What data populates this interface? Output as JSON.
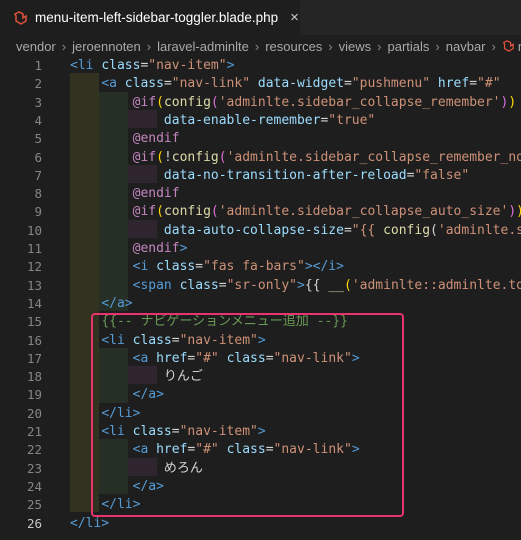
{
  "tab": {
    "filename": "menu-item-left-sidebar-toggler.blade.php",
    "close_icon": "×"
  },
  "breadcrumb": [
    "vendor",
    "jeroennoten",
    "laravel-adminlte",
    "resources",
    "views",
    "partials",
    "navbar",
    "me"
  ],
  "active_line": 26,
  "annotation_color": "#e8336e",
  "lines": [
    {
      "n": "1",
      "parts": [
        {
          "c": "t",
          "v": "<li"
        },
        {
          "c": "w",
          "v": " "
        },
        {
          "c": "a",
          "v": "class"
        },
        {
          "c": "w",
          "v": "="
        },
        {
          "c": "s",
          "v": "\"nav-item\""
        },
        {
          "c": "t",
          "v": ">"
        }
      ]
    },
    {
      "n": "2",
      "parts": [
        {
          "c": "w",
          "v": "    "
        },
        {
          "c": "t",
          "v": "<a"
        },
        {
          "c": "w",
          "v": " "
        },
        {
          "c": "a",
          "v": "class"
        },
        {
          "c": "w",
          "v": "="
        },
        {
          "c": "s",
          "v": "\"nav-link\""
        },
        {
          "c": "w",
          "v": " "
        },
        {
          "c": "a",
          "v": "data-widget"
        },
        {
          "c": "w",
          "v": "="
        },
        {
          "c": "s",
          "v": "\"pushmenu\""
        },
        {
          "c": "w",
          "v": " "
        },
        {
          "c": "a",
          "v": "href"
        },
        {
          "c": "w",
          "v": "="
        },
        {
          "c": "s",
          "v": "\"#\""
        }
      ]
    },
    {
      "n": "3",
      "parts": [
        {
          "c": "w",
          "v": "        "
        },
        {
          "c": "k",
          "v": "@if"
        },
        {
          "c": "p",
          "v": "("
        },
        {
          "c": "f",
          "v": "config"
        },
        {
          "c": "p2",
          "v": "("
        },
        {
          "c": "s",
          "v": "'adminlte.sidebar_collapse_remember'"
        },
        {
          "c": "p2",
          "v": ")"
        },
        {
          "c": "p",
          "v": ")"
        }
      ]
    },
    {
      "n": "4",
      "parts": [
        {
          "c": "w",
          "v": "            "
        },
        {
          "c": "a",
          "v": "data-enable-remember"
        },
        {
          "c": "w",
          "v": "="
        },
        {
          "c": "s",
          "v": "\"true\""
        }
      ]
    },
    {
      "n": "5",
      "parts": [
        {
          "c": "w",
          "v": "        "
        },
        {
          "c": "k",
          "v": "@endif"
        }
      ]
    },
    {
      "n": "6",
      "parts": [
        {
          "c": "w",
          "v": "        "
        },
        {
          "c": "k",
          "v": "@if"
        },
        {
          "c": "p",
          "v": "("
        },
        {
          "c": "w",
          "v": "!"
        },
        {
          "c": "f",
          "v": "config"
        },
        {
          "c": "p2",
          "v": "("
        },
        {
          "c": "s",
          "v": "'adminlte.sidebar_collapse_remember_no_tr"
        }
      ]
    },
    {
      "n": "7",
      "parts": [
        {
          "c": "w",
          "v": "            "
        },
        {
          "c": "a",
          "v": "data-no-transition-after-reload"
        },
        {
          "c": "w",
          "v": "="
        },
        {
          "c": "s",
          "v": "\"false\""
        }
      ]
    },
    {
      "n": "8",
      "parts": [
        {
          "c": "w",
          "v": "        "
        },
        {
          "c": "k",
          "v": "@endif"
        }
      ]
    },
    {
      "n": "9",
      "parts": [
        {
          "c": "w",
          "v": "        "
        },
        {
          "c": "k",
          "v": "@if"
        },
        {
          "c": "p",
          "v": "("
        },
        {
          "c": "f",
          "v": "config"
        },
        {
          "c": "p2",
          "v": "("
        },
        {
          "c": "s",
          "v": "'adminlte.sidebar_collapse_auto_size'"
        },
        {
          "c": "p2",
          "v": ")"
        },
        {
          "c": "p",
          "v": ")"
        }
      ]
    },
    {
      "n": "10",
      "parts": [
        {
          "c": "w",
          "v": "            "
        },
        {
          "c": "a",
          "v": "data-auto-collapse-size"
        },
        {
          "c": "w",
          "v": "="
        },
        {
          "c": "s",
          "v": "\"{{ "
        },
        {
          "c": "f",
          "v": "config"
        },
        {
          "c": "w",
          "v": "("
        },
        {
          "c": "s",
          "v": "'adminlte.side"
        }
      ]
    },
    {
      "n": "11",
      "parts": [
        {
          "c": "w",
          "v": "        "
        },
        {
          "c": "k",
          "v": "@endif"
        },
        {
          "c": "t",
          "v": ">"
        }
      ]
    },
    {
      "n": "12",
      "parts": [
        {
          "c": "w",
          "v": "        "
        },
        {
          "c": "t",
          "v": "<i"
        },
        {
          "c": "w",
          "v": " "
        },
        {
          "c": "a",
          "v": "class"
        },
        {
          "c": "w",
          "v": "="
        },
        {
          "c": "s",
          "v": "\"fas fa-bars\""
        },
        {
          "c": "t",
          "v": "></i>"
        }
      ]
    },
    {
      "n": "13",
      "parts": [
        {
          "c": "w",
          "v": "        "
        },
        {
          "c": "t",
          "v": "<span"
        },
        {
          "c": "w",
          "v": " "
        },
        {
          "c": "a",
          "v": "class"
        },
        {
          "c": "w",
          "v": "="
        },
        {
          "c": "s",
          "v": "\"sr-only\""
        },
        {
          "c": "t",
          "v": ">"
        },
        {
          "c": "w",
          "v": "{{ "
        },
        {
          "c": "f",
          "v": "__"
        },
        {
          "c": "p",
          "v": "("
        },
        {
          "c": "s",
          "v": "'adminlte::adminlte.toggl"
        }
      ]
    },
    {
      "n": "14",
      "parts": [
        {
          "c": "w",
          "v": "    "
        },
        {
          "c": "t",
          "v": "</a>"
        }
      ]
    },
    {
      "n": "15",
      "parts": [
        {
          "c": "w",
          "v": "    "
        },
        {
          "c": "cm",
          "v": "{{-- ナビゲーションメニュー追加 --}}"
        }
      ]
    },
    {
      "n": "16",
      "parts": [
        {
          "c": "w",
          "v": "    "
        },
        {
          "c": "t",
          "v": "<li"
        },
        {
          "c": "w",
          "v": " "
        },
        {
          "c": "a",
          "v": "class"
        },
        {
          "c": "w",
          "v": "="
        },
        {
          "c": "s",
          "v": "\"nav-item\""
        },
        {
          "c": "t",
          "v": ">"
        }
      ]
    },
    {
      "n": "17",
      "parts": [
        {
          "c": "w",
          "v": "        "
        },
        {
          "c": "t",
          "v": "<a"
        },
        {
          "c": "w",
          "v": " "
        },
        {
          "c": "a",
          "v": "href"
        },
        {
          "c": "w",
          "v": "="
        },
        {
          "c": "s",
          "v": "\"#\""
        },
        {
          "c": "w",
          "v": " "
        },
        {
          "c": "a",
          "v": "class"
        },
        {
          "c": "w",
          "v": "="
        },
        {
          "c": "s",
          "v": "\"nav-link\""
        },
        {
          "c": "t",
          "v": ">"
        }
      ]
    },
    {
      "n": "18",
      "parts": [
        {
          "c": "w",
          "v": "            りんご"
        }
      ]
    },
    {
      "n": "19",
      "parts": [
        {
          "c": "w",
          "v": "        "
        },
        {
          "c": "t",
          "v": "</a>"
        }
      ]
    },
    {
      "n": "20",
      "parts": [
        {
          "c": "w",
          "v": "    "
        },
        {
          "c": "t",
          "v": "</li>"
        }
      ]
    },
    {
      "n": "21",
      "parts": [
        {
          "c": "w",
          "v": "    "
        },
        {
          "c": "t",
          "v": "<li"
        },
        {
          "c": "w",
          "v": " "
        },
        {
          "c": "a",
          "v": "class"
        },
        {
          "c": "w",
          "v": "="
        },
        {
          "c": "s",
          "v": "\"nav-item\""
        },
        {
          "c": "t",
          "v": ">"
        }
      ]
    },
    {
      "n": "22",
      "parts": [
        {
          "c": "w",
          "v": "        "
        },
        {
          "c": "t",
          "v": "<a"
        },
        {
          "c": "w",
          "v": " "
        },
        {
          "c": "a",
          "v": "href"
        },
        {
          "c": "w",
          "v": "="
        },
        {
          "c": "s",
          "v": "\"#\""
        },
        {
          "c": "w",
          "v": " "
        },
        {
          "c": "a",
          "v": "class"
        },
        {
          "c": "w",
          "v": "="
        },
        {
          "c": "s",
          "v": "\"nav-link\""
        },
        {
          "c": "t",
          "v": ">"
        }
      ]
    },
    {
      "n": "23",
      "parts": [
        {
          "c": "w",
          "v": "            めろん"
        }
      ]
    },
    {
      "n": "24",
      "parts": [
        {
          "c": "w",
          "v": "        "
        },
        {
          "c": "t",
          "v": "</a>"
        }
      ]
    },
    {
      "n": "25",
      "parts": [
        {
          "c": "w",
          "v": "    "
        },
        {
          "c": "t",
          "v": "</li>"
        }
      ]
    },
    {
      "n": "26",
      "parts": [
        {
          "c": "t",
          "v": "</li>"
        }
      ]
    }
  ]
}
